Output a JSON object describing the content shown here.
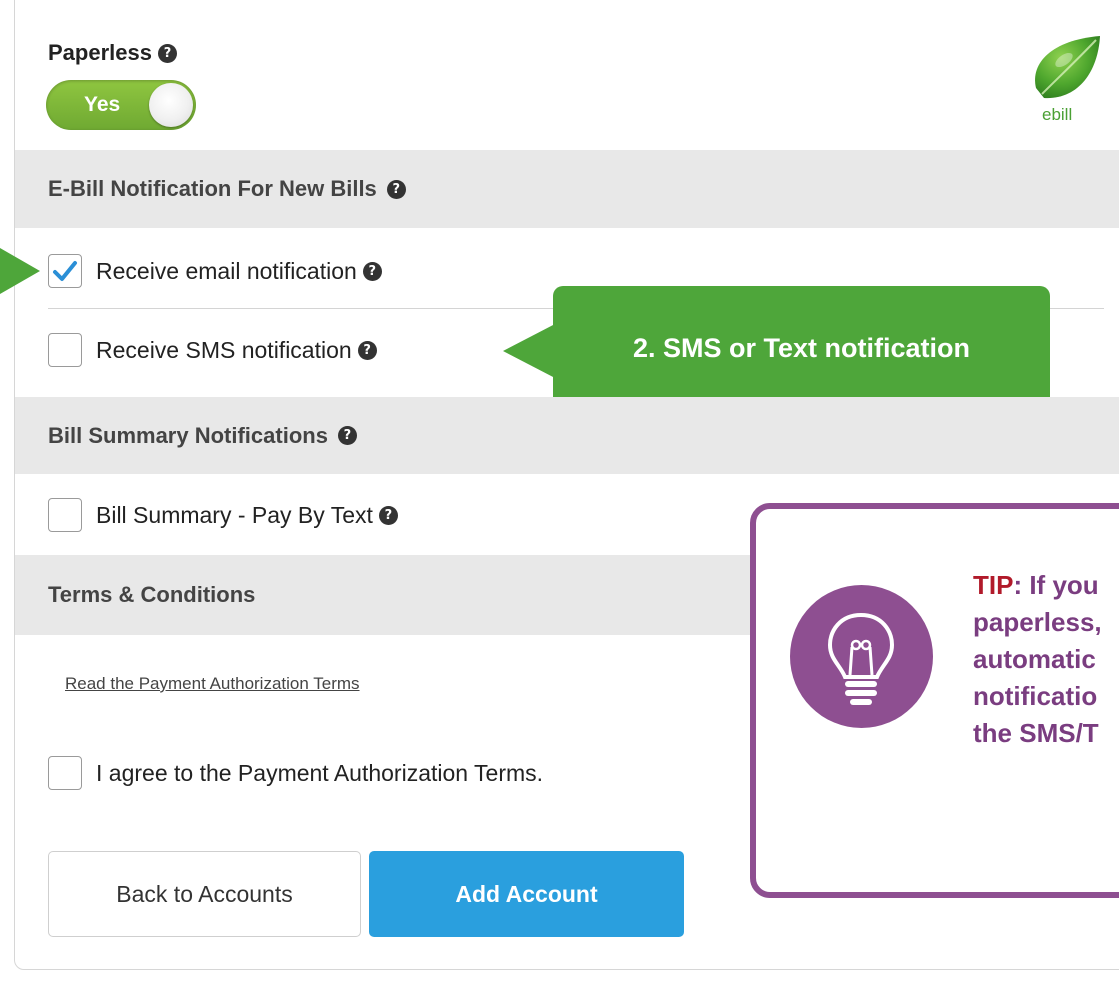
{
  "paperless": {
    "title": "Paperless",
    "toggle_value": "Yes",
    "logo_text": "ebill"
  },
  "ebill_section": {
    "header": "E-Bill Notification For New Bills",
    "email_label": "Receive email notification",
    "email_checked": true,
    "sms_label": "Receive SMS notification",
    "sms_checked": false
  },
  "callout": {
    "text": "2. SMS or Text notification"
  },
  "summary_section": {
    "header": "Bill Summary Notifications",
    "pay_by_text_label": "Bill Summary - Pay By Text",
    "pay_by_text_checked": false
  },
  "terms_section": {
    "header": "Terms & Conditions",
    "link_text": "Read the Payment Authorization Terms",
    "agree_label": "I agree to the Payment Authorization Terms.",
    "agree_checked": false
  },
  "buttons": {
    "back_label": "Back to Accounts",
    "add_label": "Add Account"
  },
  "tip": {
    "label": "TIP",
    "line1_rest": ": If you",
    "line2": "paperless,",
    "line3": "automatic",
    "line4": "notificatio",
    "line5": "the SMS/T"
  },
  "colors": {
    "toggle_green": "#7ab53a",
    "callout_green": "#4ea63a",
    "primary_blue": "#2a9fde",
    "tip_purple": "#8e4f91",
    "tip_red": "#b11a2a",
    "check_blue": "#2b8fd6"
  },
  "icons": {
    "help": "question-circle-icon",
    "check": "checkmark-icon",
    "logo": "leaf-icon",
    "tip": "lightbulb-icon"
  }
}
